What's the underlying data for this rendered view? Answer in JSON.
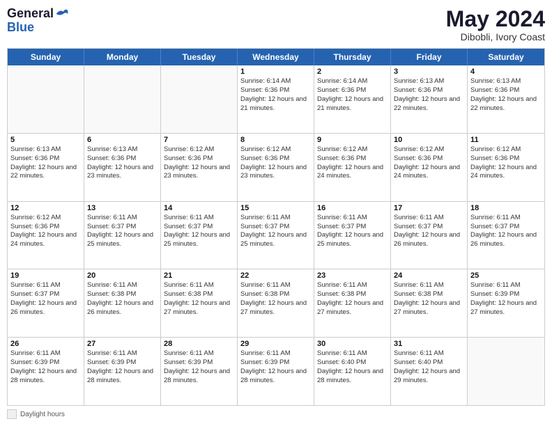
{
  "header": {
    "logo_line1": "General",
    "logo_line2": "Blue",
    "month_year": "May 2024",
    "location": "Dibobli, Ivory Coast"
  },
  "day_headers": [
    "Sunday",
    "Monday",
    "Tuesday",
    "Wednesday",
    "Thursday",
    "Friday",
    "Saturday"
  ],
  "weeks": [
    [
      {
        "day": "",
        "sunrise": "",
        "sunset": "",
        "daylight": "",
        "empty": true
      },
      {
        "day": "",
        "sunrise": "",
        "sunset": "",
        "daylight": "",
        "empty": true
      },
      {
        "day": "",
        "sunrise": "",
        "sunset": "",
        "daylight": "",
        "empty": true
      },
      {
        "day": "1",
        "sunrise": "Sunrise: 6:14 AM",
        "sunset": "Sunset: 6:36 PM",
        "daylight": "Daylight: 12 hours and 21 minutes.",
        "empty": false
      },
      {
        "day": "2",
        "sunrise": "Sunrise: 6:14 AM",
        "sunset": "Sunset: 6:36 PM",
        "daylight": "Daylight: 12 hours and 21 minutes.",
        "empty": false
      },
      {
        "day": "3",
        "sunrise": "Sunrise: 6:13 AM",
        "sunset": "Sunset: 6:36 PM",
        "daylight": "Daylight: 12 hours and 22 minutes.",
        "empty": false
      },
      {
        "day": "4",
        "sunrise": "Sunrise: 6:13 AM",
        "sunset": "Sunset: 6:36 PM",
        "daylight": "Daylight: 12 hours and 22 minutes.",
        "empty": false
      }
    ],
    [
      {
        "day": "5",
        "sunrise": "Sunrise: 6:13 AM",
        "sunset": "Sunset: 6:36 PM",
        "daylight": "Daylight: 12 hours and 22 minutes.",
        "empty": false
      },
      {
        "day": "6",
        "sunrise": "Sunrise: 6:13 AM",
        "sunset": "Sunset: 6:36 PM",
        "daylight": "Daylight: 12 hours and 23 minutes.",
        "empty": false
      },
      {
        "day": "7",
        "sunrise": "Sunrise: 6:12 AM",
        "sunset": "Sunset: 6:36 PM",
        "daylight": "Daylight: 12 hours and 23 minutes.",
        "empty": false
      },
      {
        "day": "8",
        "sunrise": "Sunrise: 6:12 AM",
        "sunset": "Sunset: 6:36 PM",
        "daylight": "Daylight: 12 hours and 23 minutes.",
        "empty": false
      },
      {
        "day": "9",
        "sunrise": "Sunrise: 6:12 AM",
        "sunset": "Sunset: 6:36 PM",
        "daylight": "Daylight: 12 hours and 24 minutes.",
        "empty": false
      },
      {
        "day": "10",
        "sunrise": "Sunrise: 6:12 AM",
        "sunset": "Sunset: 6:36 PM",
        "daylight": "Daylight: 12 hours and 24 minutes.",
        "empty": false
      },
      {
        "day": "11",
        "sunrise": "Sunrise: 6:12 AM",
        "sunset": "Sunset: 6:36 PM",
        "daylight": "Daylight: 12 hours and 24 minutes.",
        "empty": false
      }
    ],
    [
      {
        "day": "12",
        "sunrise": "Sunrise: 6:12 AM",
        "sunset": "Sunset: 6:36 PM",
        "daylight": "Daylight: 12 hours and 24 minutes.",
        "empty": false
      },
      {
        "day": "13",
        "sunrise": "Sunrise: 6:11 AM",
        "sunset": "Sunset: 6:37 PM",
        "daylight": "Daylight: 12 hours and 25 minutes.",
        "empty": false
      },
      {
        "day": "14",
        "sunrise": "Sunrise: 6:11 AM",
        "sunset": "Sunset: 6:37 PM",
        "daylight": "Daylight: 12 hours and 25 minutes.",
        "empty": false
      },
      {
        "day": "15",
        "sunrise": "Sunrise: 6:11 AM",
        "sunset": "Sunset: 6:37 PM",
        "daylight": "Daylight: 12 hours and 25 minutes.",
        "empty": false
      },
      {
        "day": "16",
        "sunrise": "Sunrise: 6:11 AM",
        "sunset": "Sunset: 6:37 PM",
        "daylight": "Daylight: 12 hours and 25 minutes.",
        "empty": false
      },
      {
        "day": "17",
        "sunrise": "Sunrise: 6:11 AM",
        "sunset": "Sunset: 6:37 PM",
        "daylight": "Daylight: 12 hours and 26 minutes.",
        "empty": false
      },
      {
        "day": "18",
        "sunrise": "Sunrise: 6:11 AM",
        "sunset": "Sunset: 6:37 PM",
        "daylight": "Daylight: 12 hours and 26 minutes.",
        "empty": false
      }
    ],
    [
      {
        "day": "19",
        "sunrise": "Sunrise: 6:11 AM",
        "sunset": "Sunset: 6:37 PM",
        "daylight": "Daylight: 12 hours and 26 minutes.",
        "empty": false
      },
      {
        "day": "20",
        "sunrise": "Sunrise: 6:11 AM",
        "sunset": "Sunset: 6:38 PM",
        "daylight": "Daylight: 12 hours and 26 minutes.",
        "empty": false
      },
      {
        "day": "21",
        "sunrise": "Sunrise: 6:11 AM",
        "sunset": "Sunset: 6:38 PM",
        "daylight": "Daylight: 12 hours and 27 minutes.",
        "empty": false
      },
      {
        "day": "22",
        "sunrise": "Sunrise: 6:11 AM",
        "sunset": "Sunset: 6:38 PM",
        "daylight": "Daylight: 12 hours and 27 minutes.",
        "empty": false
      },
      {
        "day": "23",
        "sunrise": "Sunrise: 6:11 AM",
        "sunset": "Sunset: 6:38 PM",
        "daylight": "Daylight: 12 hours and 27 minutes.",
        "empty": false
      },
      {
        "day": "24",
        "sunrise": "Sunrise: 6:11 AM",
        "sunset": "Sunset: 6:38 PM",
        "daylight": "Daylight: 12 hours and 27 minutes.",
        "empty": false
      },
      {
        "day": "25",
        "sunrise": "Sunrise: 6:11 AM",
        "sunset": "Sunset: 6:39 PM",
        "daylight": "Daylight: 12 hours and 27 minutes.",
        "empty": false
      }
    ],
    [
      {
        "day": "26",
        "sunrise": "Sunrise: 6:11 AM",
        "sunset": "Sunset: 6:39 PM",
        "daylight": "Daylight: 12 hours and 28 minutes.",
        "empty": false
      },
      {
        "day": "27",
        "sunrise": "Sunrise: 6:11 AM",
        "sunset": "Sunset: 6:39 PM",
        "daylight": "Daylight: 12 hours and 28 minutes.",
        "empty": false
      },
      {
        "day": "28",
        "sunrise": "Sunrise: 6:11 AM",
        "sunset": "Sunset: 6:39 PM",
        "daylight": "Daylight: 12 hours and 28 minutes.",
        "empty": false
      },
      {
        "day": "29",
        "sunrise": "Sunrise: 6:11 AM",
        "sunset": "Sunset: 6:39 PM",
        "daylight": "Daylight: 12 hours and 28 minutes.",
        "empty": false
      },
      {
        "day": "30",
        "sunrise": "Sunrise: 6:11 AM",
        "sunset": "Sunset: 6:40 PM",
        "daylight": "Daylight: 12 hours and 28 minutes.",
        "empty": false
      },
      {
        "day": "31",
        "sunrise": "Sunrise: 6:11 AM",
        "sunset": "Sunset: 6:40 PM",
        "daylight": "Daylight: 12 hours and 29 minutes.",
        "empty": false
      },
      {
        "day": "",
        "sunrise": "",
        "sunset": "",
        "daylight": "",
        "empty": true
      }
    ]
  ],
  "legend": {
    "box_label": "Daylight hours"
  }
}
